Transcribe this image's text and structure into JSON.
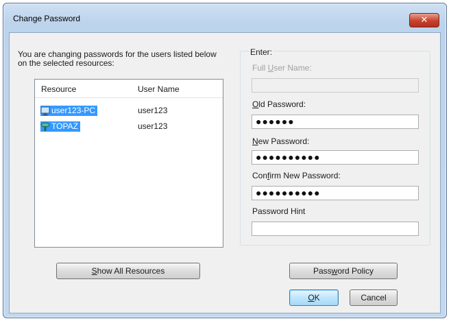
{
  "window": {
    "title": "Change Password",
    "close_glyph": "✕"
  },
  "intro_text": "You are changing passwords for the users listed below on the selected resources:",
  "list": {
    "columns": [
      "Resource",
      "User Name"
    ],
    "rows": [
      {
        "resource": "user123-PC",
        "user": "user123",
        "icon": "computer-icon"
      },
      {
        "resource": "TOPAZ",
        "user": "user123",
        "icon": "network-share-icon"
      }
    ]
  },
  "enter_group": {
    "label": "Enter:",
    "full_user_name": {
      "label_pre": "Full ",
      "label_ul": "U",
      "label_post": "ser Name:",
      "value": ""
    },
    "old_password": {
      "label_pre": "",
      "label_ul": "O",
      "label_post": "ld Password:",
      "value": "●●●●●●"
    },
    "new_password": {
      "label_pre": "",
      "label_ul": "N",
      "label_post": "ew Password:",
      "value": "●●●●●●●●●●"
    },
    "confirm_password": {
      "label_pre": "Con",
      "label_ul": "f",
      "label_post": "irm New Password:",
      "value": "●●●●●●●●●●"
    },
    "password_hint": {
      "label": "Password Hint",
      "value": ""
    }
  },
  "buttons": {
    "show_all": {
      "ul": "S",
      "rest": "how All Resources"
    },
    "policy": {
      "pre": "Pass",
      "ul": "w",
      "rest": "ord Policy"
    },
    "ok": {
      "ul": "O",
      "rest": "K"
    },
    "cancel": "Cancel"
  },
  "colors": {
    "selection": "#3399ff",
    "close": "#c7422e"
  }
}
